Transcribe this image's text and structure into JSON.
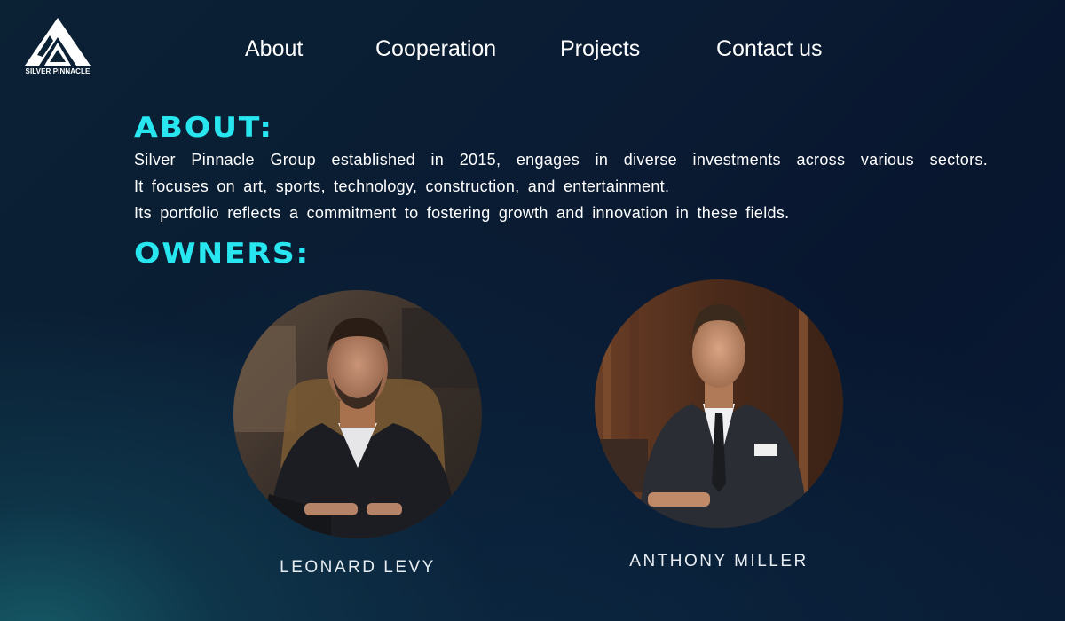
{
  "brand": {
    "name": "SILVER PINNACLE",
    "icon": "mountain-logo-icon"
  },
  "nav": {
    "items": [
      {
        "label": "About"
      },
      {
        "label": "Cooperation"
      },
      {
        "label": "Projects"
      },
      {
        "label": "Contact us"
      }
    ]
  },
  "about": {
    "heading": "ABOUT:",
    "lines": [
      "Silver Pinnacle Group established in 2015, engages in diverse investments across various sectors.",
      "It focuses on art, sports, technology, construction, and entertainment.",
      "Its portfolio reflects a commitment to fostering growth and innovation in these fields."
    ]
  },
  "owners": {
    "heading": "OWNERS:",
    "people": [
      {
        "name": "LEONARD LEVY"
      },
      {
        "name": "ANTHONY MILLER"
      }
    ]
  },
  "colors": {
    "accent": "#27e6f0",
    "background": "#0a1c33"
  }
}
